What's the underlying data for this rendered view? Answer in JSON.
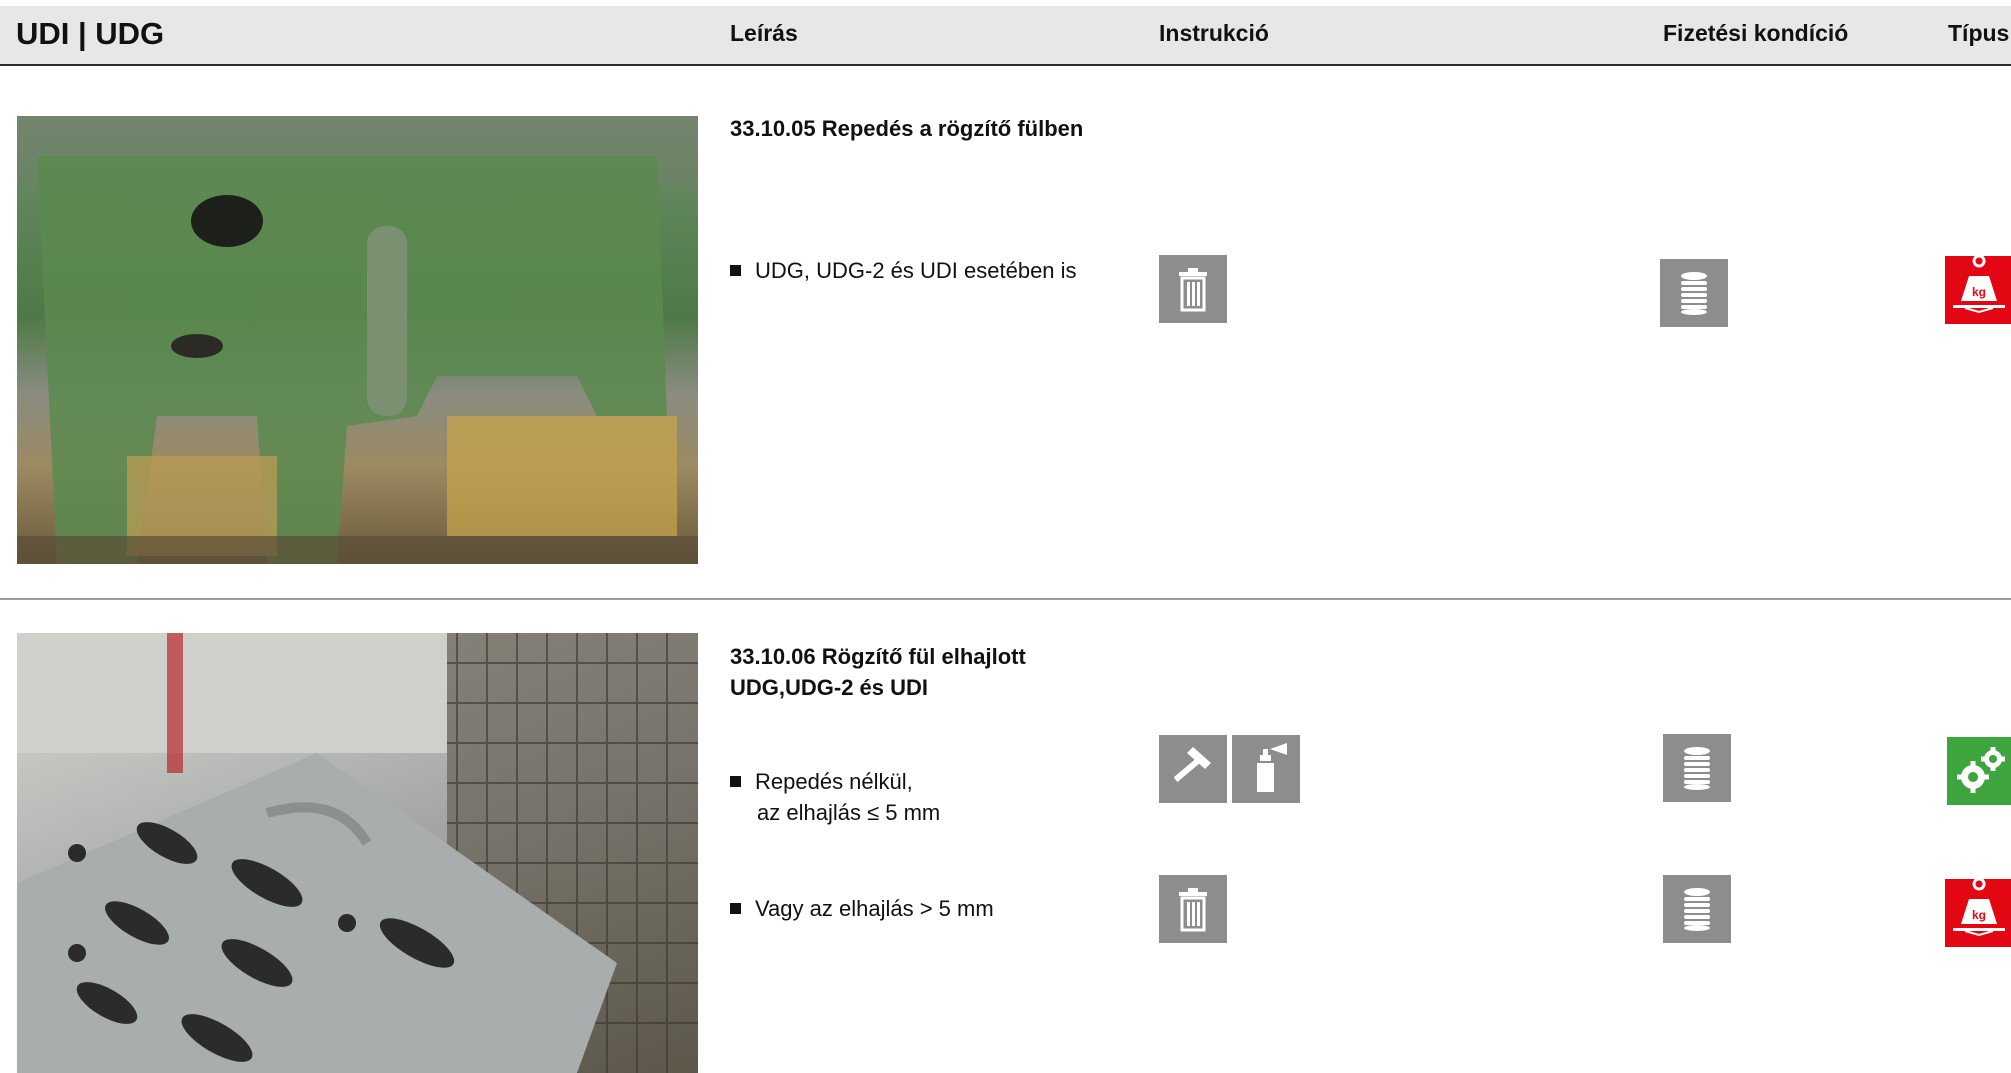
{
  "header": {
    "title": "UDI | UDG",
    "col_description": "Leírás",
    "col_instruction": "Instrukció",
    "col_payment": "Fizetési kondíció",
    "col_type": "Típus"
  },
  "sections": [
    {
      "title": "33.10.05 Repedés a rögzítő fülben",
      "photo": "damaged-green-fixing-lug-photo",
      "rows": [
        {
          "text": "UDG, UDG-2 és UDI esetében is",
          "instruction_icons": [
            "trash-icon"
          ],
          "payment_icon": "coin-stack-icon",
          "type_icon": "weight-kg-icon"
        }
      ]
    },
    {
      "title_line1": "33.10.06 Rögzítő fül elhajlott",
      "title_line2": "UDG,UDG-2 és UDI",
      "photo": "bent-steel-platform-photo",
      "rows": [
        {
          "text_line1": "Repedés nélkül,",
          "text_line2": "az elhajlás ≤ 5 mm",
          "instruction_icons": [
            "hammer-icon",
            "spray-can-icon"
          ],
          "payment_icon": "coin-stack-icon",
          "type_icon": "gears-icon"
        },
        {
          "text": "Vagy az elhajlás > 5 mm",
          "instruction_icons": [
            "trash-icon"
          ],
          "payment_icon": "coin-stack-icon",
          "type_icon": "weight-kg-icon"
        }
      ]
    }
  ],
  "icon_labels": {
    "kg": "kg"
  },
  "colors": {
    "icon_gray": "#8d8d8d",
    "type_red": "#e30613",
    "type_green": "#3ea53e",
    "header_bg": "#e7e7e7"
  }
}
